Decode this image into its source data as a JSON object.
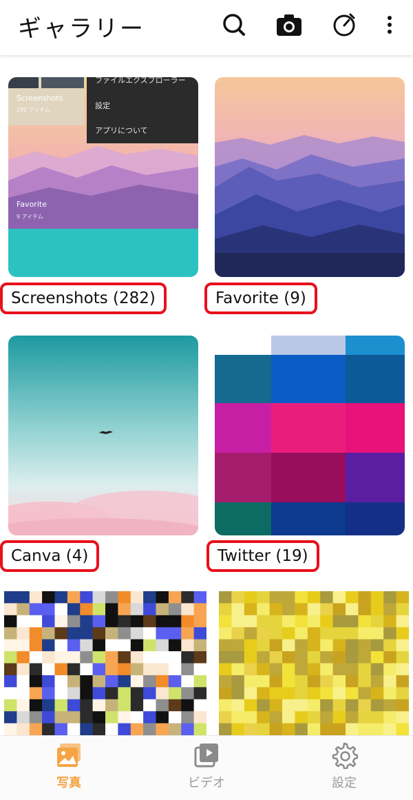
{
  "appbar": {
    "title": "ギャラリー",
    "icons": [
      "search-icon",
      "camera-icon",
      "clean-icon",
      "more-vertical-icon"
    ]
  },
  "albums": [
    {
      "name": "Screenshots",
      "label": "Screenshots (282)",
      "preview": {
        "menu_items": [
          "ファイルエクスプローラー",
          "設定",
          "アプリについて"
        ],
        "inner_album_1": "Screenshots",
        "inner_album_1_sub": "282 アイテム",
        "inner_album_2": "Favorite",
        "inner_album_2_sub": "9 アイテム"
      }
    },
    {
      "name": "Favorite",
      "label": "Favorite (9)"
    },
    {
      "name": "Canva",
      "label": "Canva (4)"
    },
    {
      "name": "Twitter",
      "label": "Twitter (19)"
    }
  ],
  "bottom_nav": [
    {
      "label": "写真",
      "icon": "photo-icon",
      "active": true
    },
    {
      "label": "ビデオ",
      "icon": "video-icon",
      "active": false
    },
    {
      "label": "設定",
      "icon": "gear-icon",
      "active": false
    }
  ],
  "colors": {
    "accent": "#f5a443",
    "highlight_border": "#e8101b",
    "inactive": "#9a9a9a"
  }
}
